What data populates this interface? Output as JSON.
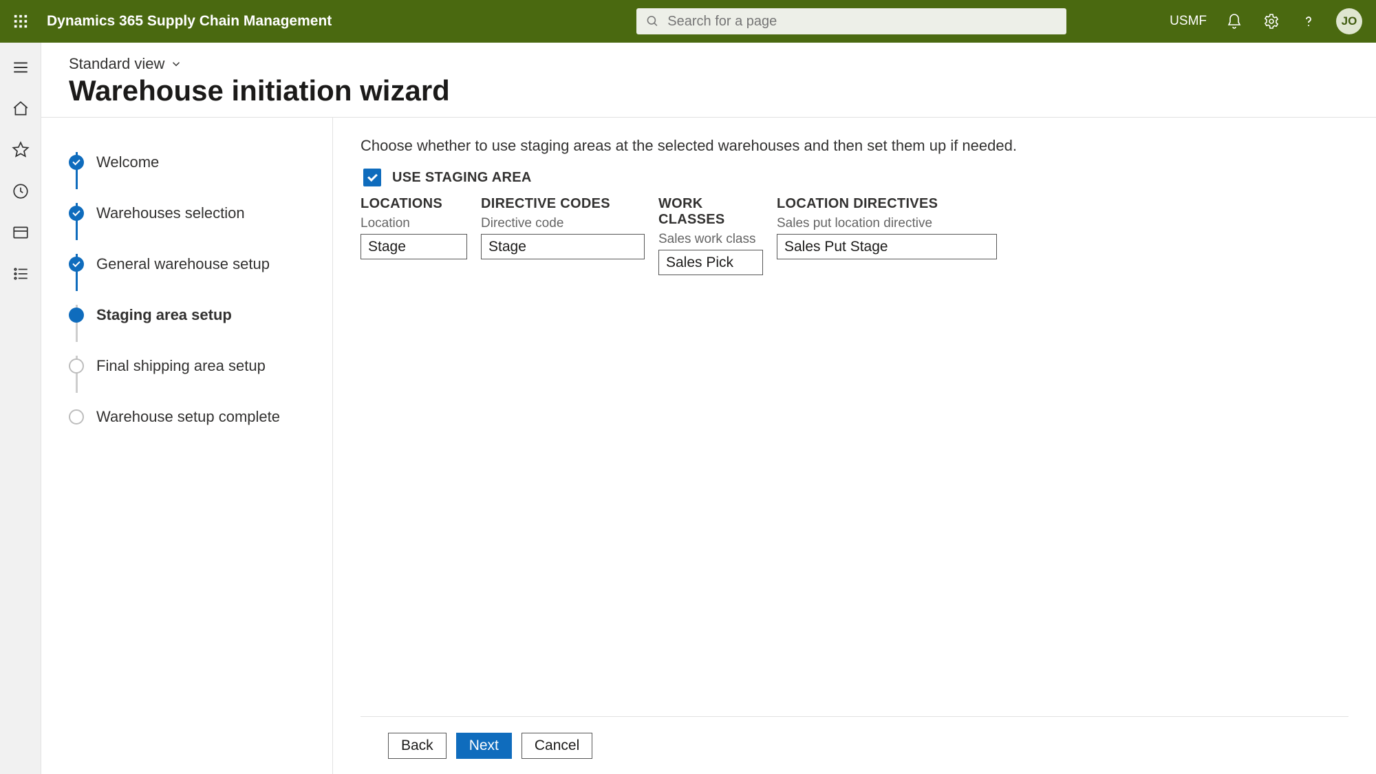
{
  "header": {
    "app_title": "Dynamics 365 Supply Chain Management",
    "search_placeholder": "Search for a page",
    "company": "USMF",
    "avatar_initials": "JO"
  },
  "page": {
    "view_label": "Standard view",
    "title": "Warehouse initiation wizard"
  },
  "steps": [
    {
      "label": "Welcome",
      "state": "done"
    },
    {
      "label": "Warehouses selection",
      "state": "done"
    },
    {
      "label": "General warehouse setup",
      "state": "done"
    },
    {
      "label": "Staging area setup",
      "state": "current"
    },
    {
      "label": "Final shipping area setup",
      "state": "todo"
    },
    {
      "label": "Warehouse setup complete",
      "state": "todo"
    }
  ],
  "form": {
    "instructions": "Choose whether to use staging areas at the selected warehouses and then set them up if needed.",
    "use_staging_label": "USE STAGING AREA",
    "use_staging_checked": true,
    "columns": [
      {
        "head": "LOCATIONS",
        "label": "Location",
        "value": "Stage"
      },
      {
        "head": "DIRECTIVE CODES",
        "label": "Directive code",
        "value": "Stage"
      },
      {
        "head": "WORK CLASSES",
        "label": "Sales work class",
        "value": "Sales Pick"
      },
      {
        "head": "LOCATION DIRECTIVES",
        "label": "Sales put location directive",
        "value": "Sales Put Stage"
      }
    ]
  },
  "buttons": {
    "back": "Back",
    "next": "Next",
    "cancel": "Cancel"
  }
}
